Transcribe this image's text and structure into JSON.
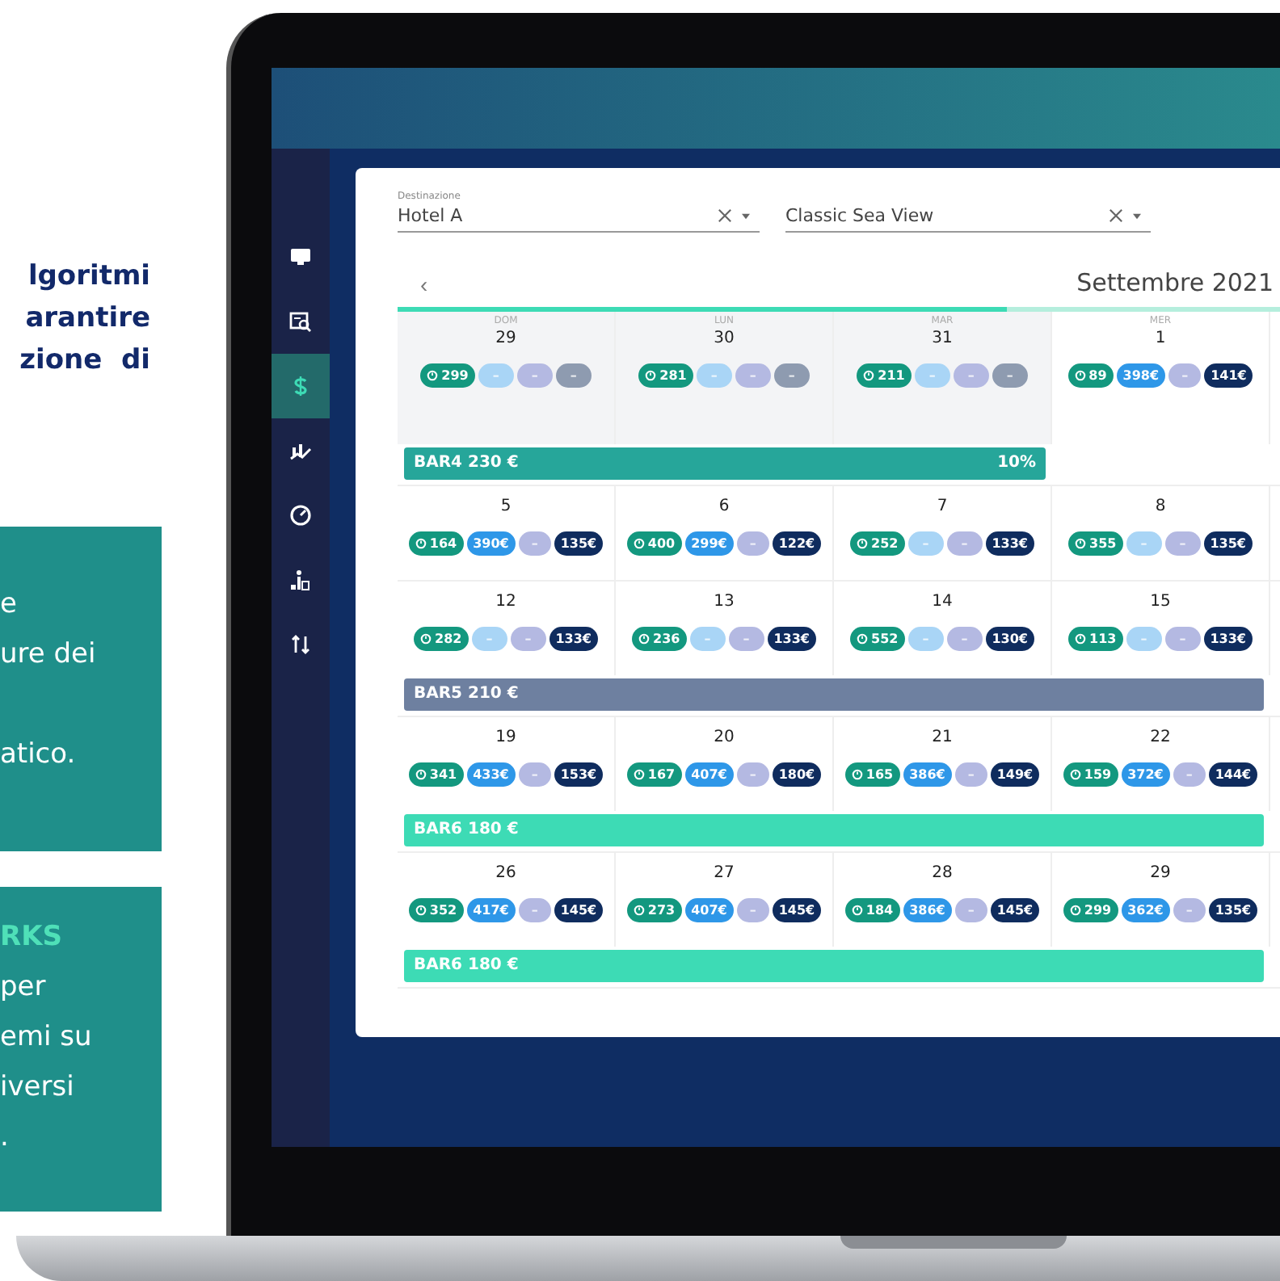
{
  "promo": {
    "heading_lines": [
      "lgoritmi",
      "arantire",
      "zione  di"
    ],
    "cards": [
      {
        "paragraphs": [
          [
            "e",
            "ure dei"
          ],
          [
            "atico."
          ]
        ]
      },
      {
        "title": "RKS",
        "paragraphs": [
          [
            "per",
            "emi su",
            "iversi",
            "."
          ]
        ]
      }
    ]
  },
  "app": {
    "sidebar": {
      "items": [
        {
          "kind": "monitor",
          "selected": false
        },
        {
          "kind": "report",
          "selected": false
        },
        {
          "kind": "price",
          "selected": true
        },
        {
          "kind": "trend",
          "selected": false
        },
        {
          "kind": "gauge",
          "selected": false
        },
        {
          "kind": "ranking",
          "selected": false
        },
        {
          "kind": "sort",
          "selected": false
        }
      ]
    },
    "filters": [
      {
        "label": "Destinazione",
        "value": "Hotel A"
      },
      {
        "value": "Classic Sea View"
      }
    ],
    "calendar": {
      "prev_button": "‹",
      "month": "Settembre 2021",
      "range_bar": {
        "level": 0.69
      },
      "weekdays": [
        "DOM",
        "LUN",
        "MAR",
        "MER"
      ],
      "weeks": [
        {
          "days": [
            {
              "date": "29",
              "outside_month": true,
              "pills": [
                {
                  "kind": "occupancy",
                  "text": "299"
                },
                {
                  "kind": "sky",
                  "text": "–"
                },
                {
                  "kind": "lavender",
                  "text": "–"
                },
                {
                  "kind": "slate",
                  "text": "–"
                }
              ]
            },
            {
              "date": "30",
              "outside_month": true,
              "pills": [
                {
                  "kind": "occupancy",
                  "text": "281"
                },
                {
                  "kind": "sky",
                  "text": "–"
                },
                {
                  "kind": "lavender",
                  "text": "–"
                },
                {
                  "kind": "slate",
                  "text": "–"
                }
              ]
            },
            {
              "date": "31",
              "outside_month": true,
              "pills": [
                {
                  "kind": "occupancy",
                  "text": "211"
                },
                {
                  "kind": "sky",
                  "text": "–"
                },
                {
                  "kind": "lavender",
                  "text": "–"
                },
                {
                  "kind": "slate",
                  "text": "–"
                }
              ]
            },
            {
              "date": "1",
              "outside_month": false,
              "pills": [
                {
                  "kind": "occupancy",
                  "text": "89"
                },
                {
                  "kind": "blue",
                  "text": "398€"
                },
                {
                  "kind": "lavender",
                  "text": "–"
                },
                {
                  "kind": "navy",
                  "text": "141€"
                }
              ]
            }
          ],
          "banner": {
            "text": "BAR4 230 €",
            "discount": "10%",
            "color": "#26a69a",
            "covers_last_day": false
          }
        },
        {
          "days": [
            {
              "date": "5",
              "outside_month": false,
              "pills": [
                {
                  "kind": "occupancy",
                  "text": "164"
                },
                {
                  "kind": "blue",
                  "text": "390€"
                },
                {
                  "kind": "lavender",
                  "text": "–"
                },
                {
                  "kind": "navy",
                  "text": "135€"
                }
              ]
            },
            {
              "date": "6",
              "outside_month": false,
              "pills": [
                {
                  "kind": "occupancy",
                  "text": "400"
                },
                {
                  "kind": "blue",
                  "text": "299€"
                },
                {
                  "kind": "lavender",
                  "text": "–"
                },
                {
                  "kind": "navy",
                  "text": "122€"
                }
              ]
            },
            {
              "date": "7",
              "outside_month": false,
              "pills": [
                {
                  "kind": "occupancy",
                  "text": "252"
                },
                {
                  "kind": "sky",
                  "text": "–"
                },
                {
                  "kind": "lavender",
                  "text": "–"
                },
                {
                  "kind": "navy",
                  "text": "133€"
                }
              ]
            },
            {
              "date": "8",
              "outside_month": false,
              "pills": [
                {
                  "kind": "occupancy",
                  "text": "355"
                },
                {
                  "kind": "sky",
                  "text": "–"
                },
                {
                  "kind": "lavender",
                  "text": "–"
                },
                {
                  "kind": "navy",
                  "text": "135€"
                }
              ]
            }
          ]
        },
        {
          "days": [
            {
              "date": "12",
              "outside_month": false,
              "pills": [
                {
                  "kind": "occupancy",
                  "text": "282"
                },
                {
                  "kind": "sky",
                  "text": "–"
                },
                {
                  "kind": "lavender",
                  "text": "–"
                },
                {
                  "kind": "navy",
                  "text": "133€"
                }
              ]
            },
            {
              "date": "13",
              "outside_month": false,
              "pills": [
                {
                  "kind": "occupancy",
                  "text": "236"
                },
                {
                  "kind": "sky",
                  "text": "–"
                },
                {
                  "kind": "lavender",
                  "text": "–"
                },
                {
                  "kind": "navy",
                  "text": "133€"
                }
              ]
            },
            {
              "date": "14",
              "outside_month": false,
              "pills": [
                {
                  "kind": "occupancy",
                  "text": "552"
                },
                {
                  "kind": "sky",
                  "text": "–"
                },
                {
                  "kind": "lavender",
                  "text": "–"
                },
                {
                  "kind": "navy",
                  "text": "130€"
                }
              ]
            },
            {
              "date": "15",
              "outside_month": false,
              "pills": [
                {
                  "kind": "occupancy",
                  "text": "113"
                },
                {
                  "kind": "sky",
                  "text": "–"
                },
                {
                  "kind": "lavender",
                  "text": "–"
                },
                {
                  "kind": "navy",
                  "text": "133€"
                }
              ]
            }
          ],
          "banner": {
            "text": "BAR5 210 €",
            "color": "#6e80a0",
            "covers_last_day": true
          }
        },
        {
          "days": [
            {
              "date": "19",
              "outside_month": false,
              "pills": [
                {
                  "kind": "occupancy",
                  "text": "341"
                },
                {
                  "kind": "blue",
                  "text": "433€"
                },
                {
                  "kind": "lavender",
                  "text": "–"
                },
                {
                  "kind": "navy",
                  "text": "153€"
                }
              ]
            },
            {
              "date": "20",
              "outside_month": false,
              "pills": [
                {
                  "kind": "occupancy",
                  "text": "167"
                },
                {
                  "kind": "blue",
                  "text": "407€"
                },
                {
                  "kind": "lavender",
                  "text": "–"
                },
                {
                  "kind": "navy",
                  "text": "180€"
                }
              ]
            },
            {
              "date": "21",
              "outside_month": false,
              "pills": [
                {
                  "kind": "occupancy",
                  "text": "165"
                },
                {
                  "kind": "blue",
                  "text": "386€"
                },
                {
                  "kind": "lavender",
                  "text": "–"
                },
                {
                  "kind": "navy",
                  "text": "149€"
                }
              ]
            },
            {
              "date": "22",
              "outside_month": false,
              "pills": [
                {
                  "kind": "occupancy",
                  "text": "159"
                },
                {
                  "kind": "blue",
                  "text": "372€"
                },
                {
                  "kind": "lavender",
                  "text": "–"
                },
                {
                  "kind": "navy",
                  "text": "144€"
                }
              ]
            }
          ],
          "banner": {
            "text": "BAR6 180 €",
            "color": "#3ddbb5",
            "covers_last_day": true
          }
        },
        {
          "days": [
            {
              "date": "26",
              "outside_month": false,
              "pills": [
                {
                  "kind": "occupancy",
                  "text": "352"
                },
                {
                  "kind": "blue",
                  "text": "417€"
                },
                {
                  "kind": "lavender",
                  "text": "–"
                },
                {
                  "kind": "navy",
                  "text": "145€"
                }
              ]
            },
            {
              "date": "27",
              "outside_month": false,
              "pills": [
                {
                  "kind": "occupancy",
                  "text": "273"
                },
                {
                  "kind": "blue",
                  "text": "407€"
                },
                {
                  "kind": "lavender",
                  "text": "–"
                },
                {
                  "kind": "navy",
                  "text": "145€"
                }
              ]
            },
            {
              "date": "28",
              "outside_month": false,
              "pills": [
                {
                  "kind": "occupancy",
                  "text": "184"
                },
                {
                  "kind": "blue",
                  "text": "386€"
                },
                {
                  "kind": "lavender",
                  "text": "–"
                },
                {
                  "kind": "navy",
                  "text": "145€"
                }
              ]
            },
            {
              "date": "29",
              "outside_month": false,
              "pills": [
                {
                  "kind": "occupancy",
                  "text": "299"
                },
                {
                  "kind": "blue",
                  "text": "362€"
                },
                {
                  "kind": "lavender",
                  "text": "–"
                },
                {
                  "kind": "navy",
                  "text": "135€"
                }
              ]
            }
          ],
          "banner": {
            "text": "BAR6 180 €",
            "color": "#3ddbb5",
            "covers_last_day": true
          }
        }
      ]
    }
  }
}
